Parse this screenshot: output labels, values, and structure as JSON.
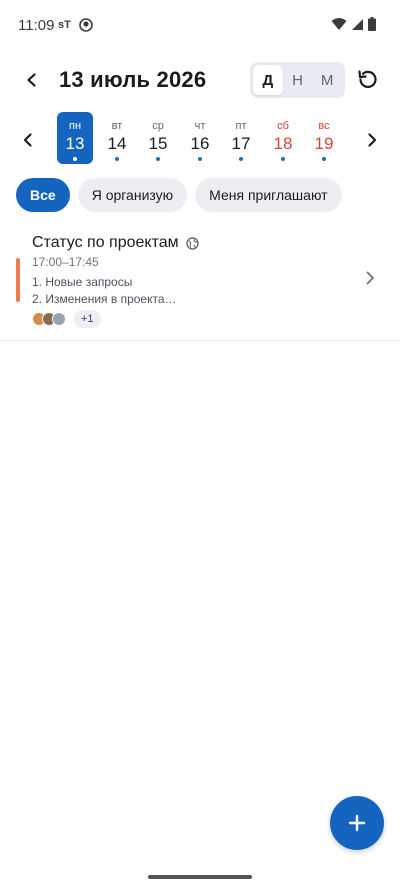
{
  "status_bar": {
    "time": "11:09",
    "carrier": "sT"
  },
  "header": {
    "title": "13 июль 2026",
    "view_modes": [
      {
        "label": "Д",
        "active": true
      },
      {
        "label": "Н",
        "active": false
      },
      {
        "label": "М",
        "active": false
      }
    ]
  },
  "week": {
    "days": [
      {
        "name": "пн",
        "num": "13",
        "selected": true,
        "weekend": false
      },
      {
        "name": "вт",
        "num": "14",
        "selected": false,
        "weekend": false
      },
      {
        "name": "ср",
        "num": "15",
        "selected": false,
        "weekend": false
      },
      {
        "name": "чт",
        "num": "16",
        "selected": false,
        "weekend": false
      },
      {
        "name": "пт",
        "num": "17",
        "selected": false,
        "weekend": false
      },
      {
        "name": "сб",
        "num": "18",
        "selected": false,
        "weekend": true
      },
      {
        "name": "вс",
        "num": "19",
        "selected": false,
        "weekend": true
      }
    ]
  },
  "filters": [
    {
      "label": "Все",
      "active": true
    },
    {
      "label": "Я организую",
      "active": false
    },
    {
      "label": "Меня приглашают",
      "active": false
    }
  ],
  "event": {
    "title": "Статус по проектам",
    "time": "17:00–17:45",
    "agenda_line1": "1. Новые запросы",
    "agenda_line2": "2. Изменения в проекта…",
    "more_attendees": "+1",
    "accent_color": "#f27c4b"
  },
  "colors": {
    "primary": "#1565c0",
    "weekend": "#d0453b",
    "dot": "#1f6fbf"
  }
}
